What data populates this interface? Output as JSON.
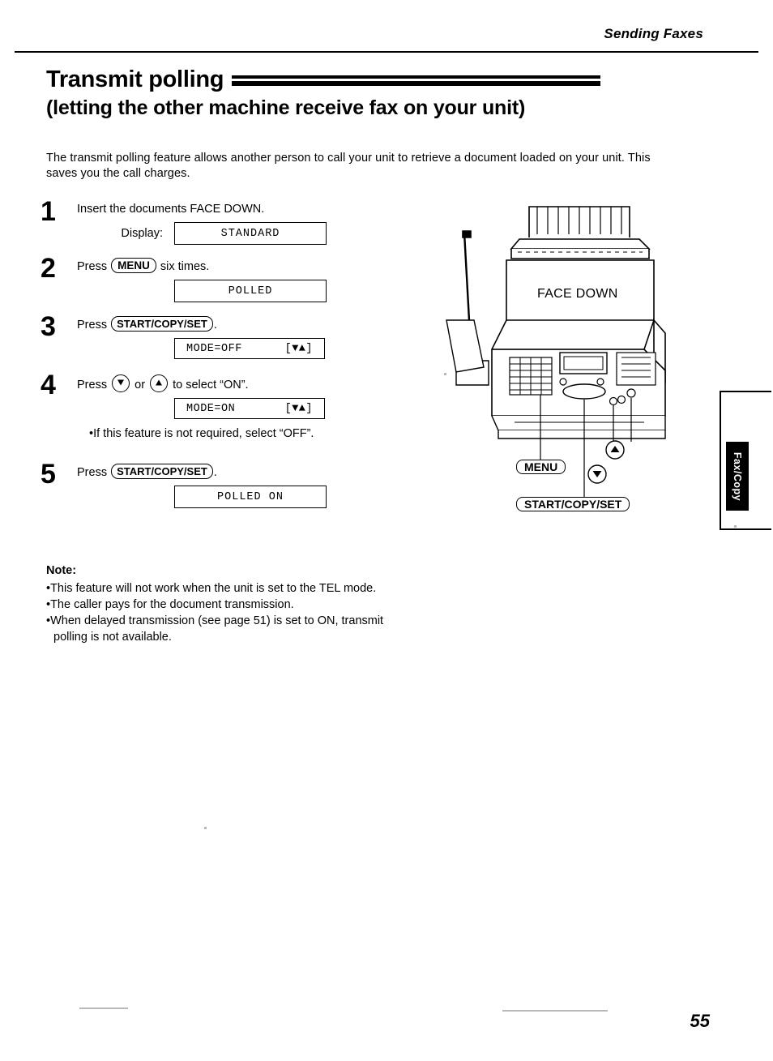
{
  "header": {
    "running_head": "Sending Faxes"
  },
  "title": {
    "line1": "Transmit polling",
    "line2": "(letting the other machine receive fax on your unit)"
  },
  "intro": "The transmit polling feature allows another person to call your unit to retrieve a document loaded on your unit. This saves you the call charges.",
  "steps": [
    {
      "number": "1",
      "text_before": "Insert the documents FACE DOWN.",
      "display_label": "Display:",
      "lcd": "STANDARD"
    },
    {
      "number": "2",
      "text_before": "Press",
      "key": "MENU",
      "text_after": "six times.",
      "lcd": "POLLED"
    },
    {
      "number": "3",
      "text_before": "Press",
      "key": "START/COPY/SET",
      "text_after": ".",
      "lcd_left": "MODE=OFF",
      "lcd_right": "[▼▲]"
    },
    {
      "number": "4",
      "text_before": "Press",
      "text_mid": "or",
      "text_after": "to select “ON”.",
      "lcd_left": "MODE=ON",
      "lcd_right": "[▼▲]",
      "note": "•If this feature is not required, select “OFF”."
    },
    {
      "number": "5",
      "text_before": "Press",
      "key": "START/COPY/SET",
      "text_after": ".",
      "lcd": "POLLED ON"
    }
  ],
  "note": {
    "title": "Note:",
    "items": [
      "•This feature will not work when the unit is set to the TEL mode.",
      "•The caller pays for the document transmission.",
      "•When delayed transmission (see page 51) is set to ON, transmit polling is not available."
    ]
  },
  "illustration": {
    "face_down_label": "FACE DOWN",
    "callout_menu": "MENU",
    "callout_start": "START/COPY/SET"
  },
  "side_tab": {
    "label": "Fax/Copy"
  },
  "page_number": "55"
}
